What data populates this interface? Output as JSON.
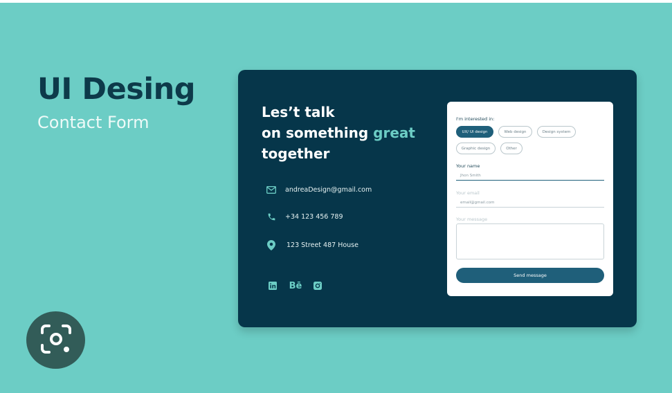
{
  "hero": {
    "title": "UI Desing",
    "subtitle": "Contact Form"
  },
  "card": {
    "headline": {
      "line1": "Les’t talk",
      "line2_prefix": "on something ",
      "line2_accent": "great",
      "line3": "together"
    },
    "contacts": [
      {
        "icon": "mail-icon",
        "text": "andreaDesign@gmail.com"
      },
      {
        "icon": "phone-icon",
        "text": "+34 123 456 789"
      },
      {
        "icon": "location-pin-icon",
        "text": "123 Street 487 House"
      }
    ],
    "social": [
      {
        "icon": "linkedin-icon",
        "label": ""
      },
      {
        "icon": "behance-icon",
        "label": "Bē"
      },
      {
        "icon": "instagram-icon",
        "label": ""
      }
    ]
  },
  "form": {
    "interested_label": "I'm interested in:",
    "chips": [
      {
        "label": "UX/ UI design",
        "selected": true
      },
      {
        "label": "Web design",
        "selected": false
      },
      {
        "label": "Design system",
        "selected": false
      },
      {
        "label": "Graphic design",
        "selected": false
      },
      {
        "label": "Other",
        "selected": false
      }
    ],
    "name_label": "Your name",
    "name_value": "Jhon Smith",
    "email_label": "Your email",
    "email_value": "email@gmail.com",
    "message_label": "Your message",
    "message_value": "",
    "send_label": "Send message"
  },
  "colors": {
    "background": "#6ccdc5",
    "card": "#06364a",
    "accent": "#6ccdc5",
    "button": "#1f5f7a",
    "title": "#0d3a4a"
  },
  "overlay": {
    "icon": "lens-camera-icon"
  }
}
